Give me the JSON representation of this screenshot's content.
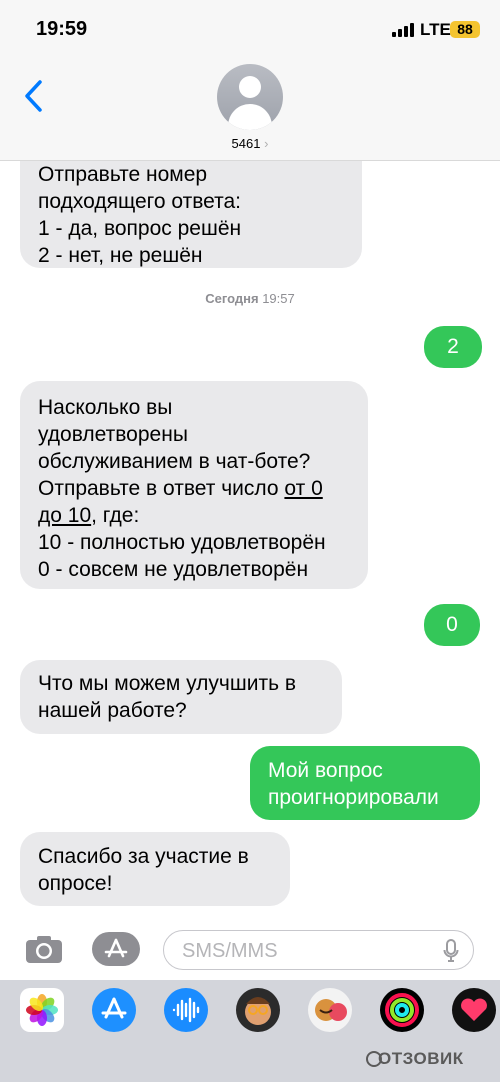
{
  "status_bar": {
    "time": "19:59",
    "network": "LTE",
    "battery": "88"
  },
  "header": {
    "contact_name": "5461",
    "contact_chevron": "›"
  },
  "messages": [
    {
      "side": "in",
      "text": "Отправьте номер\nподходящего ответа:\n1 - да, вопрос решён\n2 - нет, не решён"
    },
    {
      "side": "timestamp",
      "day": "Сегодня",
      "time": "19:57"
    },
    {
      "side": "out",
      "text": "2"
    },
    {
      "side": "in",
      "text_before": "Насколько вы\nудовлетворены\nобслуживанием в чат-боте?\nОтправьте в ответ число ",
      "link1": "от 0",
      "newline": "\n",
      "link2": "до 10",
      "text_after": ", где:\n10 - полностью удовлетворён\n0 - совсем не удовлетворён"
    },
    {
      "side": "out",
      "text": "0"
    },
    {
      "side": "in",
      "text": "Что мы можем улучшить в\nнашей работе?"
    },
    {
      "side": "out",
      "text": "Мой вопрос\nпроигнорировали"
    },
    {
      "side": "in",
      "text": "Спасибо за участие в\nопросе!"
    }
  ],
  "input": {
    "placeholder": "SMS/MMS"
  },
  "app_drawer": [
    "photos-icon",
    "app-store-icon",
    "audio-messages-icon",
    "memoji-icon",
    "memoji-stickers-icon",
    "activity-icon",
    "heart-digital-touch-icon"
  ],
  "watermark": "ОТЗОВИК",
  "colors": {
    "incoming_bubble": "#e9e9eb",
    "outgoing_bubble": "#34c759",
    "back_arrow": "#007aff"
  }
}
